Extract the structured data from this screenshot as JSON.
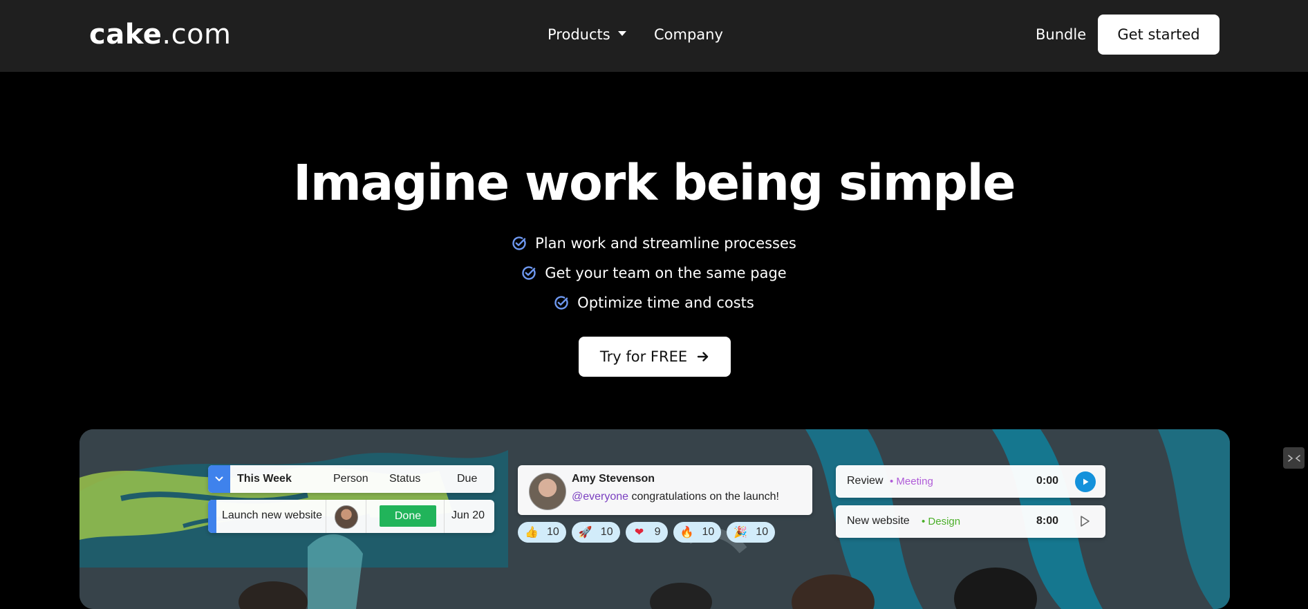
{
  "header": {
    "logo_bold": "cake",
    "logo_light": ".com",
    "nav": {
      "products": "Products",
      "company": "Company"
    },
    "bundle": "Bundle",
    "cta": "Get started"
  },
  "hero": {
    "title": "Imagine work being simple",
    "features": [
      "Plan work and streamline processes",
      "Get your team on the same page",
      "Optimize time and costs"
    ],
    "cta": "Try for FREE"
  },
  "preview": {
    "task_table": {
      "group": "This Week",
      "columns": [
        "Person",
        "Status",
        "Due"
      ],
      "row": {
        "task": "Launch new website",
        "status": "Done",
        "due": "Jun 20"
      }
    },
    "chat": {
      "author": "Amy Stevenson",
      "mention": "@everyone",
      "text": " congratulations on the launch!",
      "reactions": [
        {
          "icon": "thumbs-up",
          "glyph": "👍",
          "count": "10"
        },
        {
          "icon": "rocket",
          "glyph": "🚀",
          "count": "10"
        },
        {
          "icon": "heart",
          "glyph": "❤",
          "count": "9"
        },
        {
          "icon": "fire",
          "glyph": "🔥",
          "count": "10"
        },
        {
          "icon": "party-popper",
          "glyph": "🎉",
          "count": "10"
        }
      ]
    },
    "timers": [
      {
        "title": "Review",
        "tag": "Meeting",
        "tag_color": "#b05cd8",
        "time": "0:00",
        "active": true
      },
      {
        "title": "New website",
        "tag": "Design",
        "tag_color": "#4caf2a",
        "time": "8:00",
        "active": false
      }
    ]
  },
  "colors": {
    "header_bg": "#1f1f1f",
    "page_bg": "#000000",
    "accent_blue": "#3f82ec",
    "status_done": "#21b45a",
    "check_icon": "#6e98f0"
  }
}
